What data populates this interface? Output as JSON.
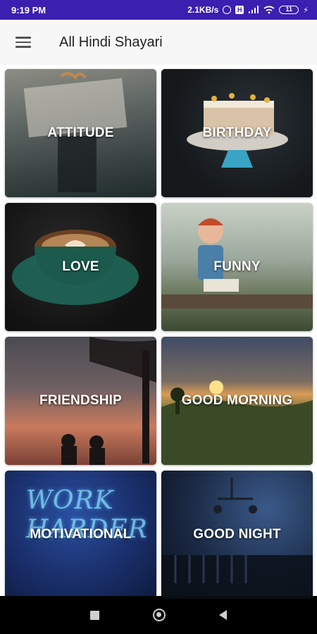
{
  "status_bar": {
    "time": "9:19 PM",
    "network_speed": "2.1KB/s",
    "sim_label": "H",
    "battery": "11",
    "icons": [
      "alarm-icon",
      "sim-icon",
      "signal-icon",
      "wifi-icon",
      "battery-icon",
      "charging-icon"
    ]
  },
  "app_bar": {
    "title": "All Hindi Shayari",
    "menu_icon": "hamburger-menu-icon"
  },
  "categories": [
    {
      "label": "ATTITUDE"
    },
    {
      "label": "BIRTHDAY"
    },
    {
      "label": "LOVE"
    },
    {
      "label": "FUNNY"
    },
    {
      "label": "FRIENDSHIP"
    },
    {
      "label": "GOOD MORNING"
    },
    {
      "label": "MOTIVATIONAL",
      "image_text": "WORK HARDER"
    },
    {
      "label": "GOOD NIGHT"
    }
  ],
  "nav_bar": {
    "icons": [
      "recent-apps-icon",
      "home-icon",
      "back-icon"
    ]
  },
  "colors": {
    "status_bar": "#3a1fb0",
    "app_bar": "#f7f7f7",
    "nav_bar": "#000000"
  }
}
